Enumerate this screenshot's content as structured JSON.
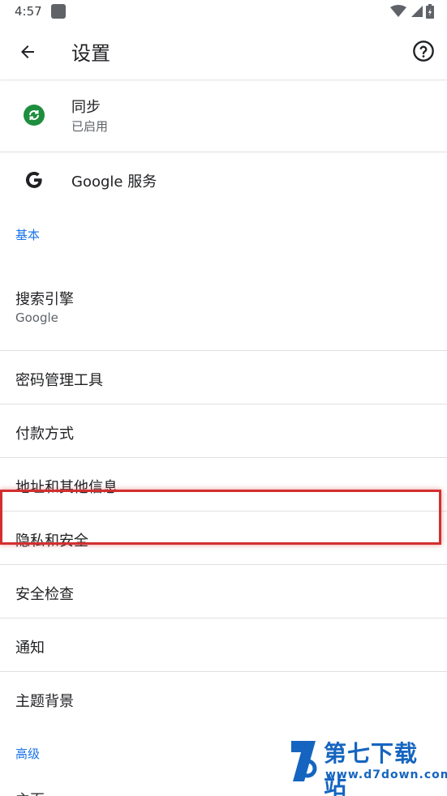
{
  "status_bar": {
    "time": "4:57",
    "icons": [
      "wifi-icon",
      "signal-icon",
      "battery-charging-icon"
    ]
  },
  "app_bar": {
    "title": "设置",
    "back_icon": "arrow-back-icon",
    "help_icon": "help-circle-icon"
  },
  "account": {
    "sync": {
      "title": "同步",
      "subtitle": "已启用",
      "icon": "sync-icon",
      "icon_color": "#1e8e3e"
    },
    "google_services": {
      "title": "Google 服务",
      "icon": "google-g-icon"
    }
  },
  "sections": {
    "basic": {
      "header": "基本"
    },
    "advanced": {
      "header": "高级"
    }
  },
  "basic_items": {
    "search_engine": {
      "title": "搜索引擎",
      "subtitle": "Google"
    },
    "passwords": {
      "title": "密码管理工具"
    },
    "payments": {
      "title": "付款方式"
    },
    "addresses": {
      "title": "地址和其他信息"
    },
    "privacy": {
      "title": "隐私和安全"
    },
    "safety_check": {
      "title": "安全检查"
    },
    "notifications": {
      "title": "通知"
    },
    "theme": {
      "title": "主题背景"
    }
  },
  "advanced_items": {
    "homepage": {
      "title": "主页"
    }
  },
  "watermark": {
    "title": "第七下载站",
    "url": "www.d7down.com"
  },
  "colors": {
    "accent": "#1a73e8",
    "highlight": "#d32f2f",
    "sync_green": "#1e8e3e"
  }
}
